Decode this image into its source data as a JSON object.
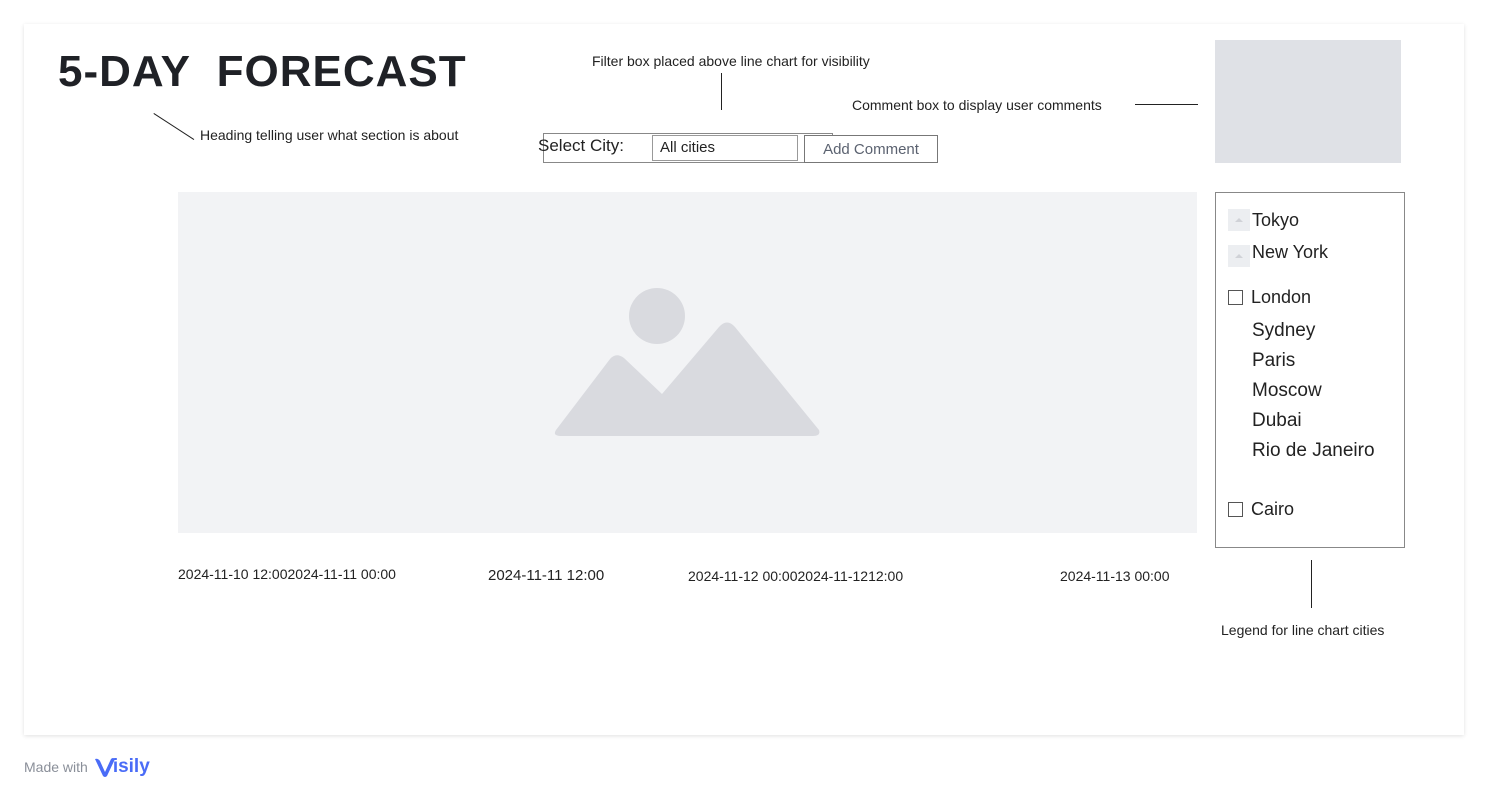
{
  "heading": "5-DAY  FORECAST",
  "annotations": {
    "heading_note": "Heading telling user what section is about",
    "filter_note": "Filter box placed above line chart  for visibility",
    "comment_note": "Comment box to display user comments",
    "legend_note": "Legend for line chart cities"
  },
  "filter": {
    "label": "Select City:",
    "value": "All cities"
  },
  "add_comment_label": "Add Comment",
  "x_ticks": [
    "2024-11-10 12:002024-11-11 00:00",
    "2024-11-11 12:00",
    "2024-11-12 00:002024-11-1212:00",
    "2024-11-13 00:00"
  ],
  "legend": {
    "items": [
      {
        "label": "Tokyo",
        "marker": "image-thumbnail-icon"
      },
      {
        "label": "New York",
        "marker": "image-thumbnail-icon"
      },
      {
        "label": "London",
        "marker": "checkbox"
      },
      {
        "label": "Sydney",
        "marker": "none"
      },
      {
        "label": "Paris",
        "marker": "none"
      },
      {
        "label": "Moscow",
        "marker": "none"
      },
      {
        "label": "Dubai",
        "marker": "none"
      },
      {
        "label": "Rio de Janeiro",
        "marker": "none"
      },
      {
        "label": "Cairo",
        "marker": "checkbox"
      }
    ]
  },
  "footer": {
    "made_with": "Made with",
    "brand": "isily",
    "brand_color": "#4a6cf7"
  },
  "colors": {
    "placeholder_bg": "#f2f3f5",
    "placeholder_shape": "#d9dadf",
    "comment_box_bg": "#dfe1e6"
  }
}
